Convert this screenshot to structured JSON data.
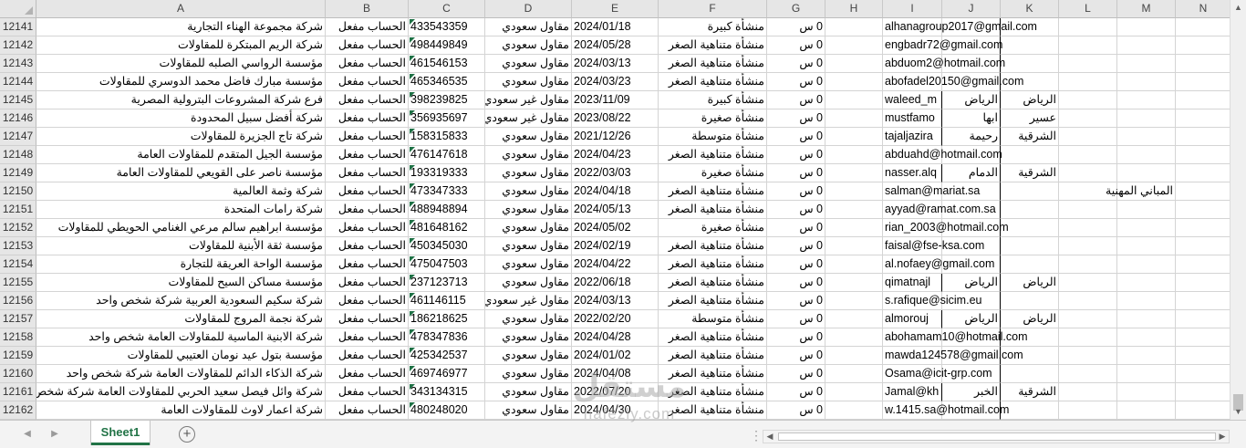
{
  "columns": [
    "A",
    "B",
    "C",
    "D",
    "E",
    "F",
    "G",
    "H",
    "I",
    "J",
    "K",
    "L",
    "M",
    "N"
  ],
  "rows": [
    {
      "num": "12141",
      "A": "شركة مجموعة الهناء التجارية",
      "B": "الحساب مفعل",
      "C": "433543359",
      "D": "مقاول سعودي",
      "E": "2024/01/18",
      "F": "منشأة كبيرة",
      "G": "0 س",
      "H": "",
      "I": "alhanagroup2017@gmail.com",
      "J": "",
      "K": "",
      "L": "",
      "M": ""
    },
    {
      "num": "12142",
      "A": "شركة الريم المبتكرة للمقاولات",
      "B": "الحساب مفعل",
      "C": "498449849",
      "D": "مقاول سعودي",
      "E": "2024/05/28",
      "F": "منشأة متناهية الصغر",
      "G": "0 س",
      "H": "",
      "I": "engbadr72@gmail.com",
      "J": "",
      "K": "",
      "L": "",
      "M": ""
    },
    {
      "num": "12143",
      "A": "مؤسسة الرواسي الصلبه للمقاولات",
      "B": "الحساب مفعل",
      "C": "461546153",
      "D": "مقاول سعودي",
      "E": "2024/03/13",
      "F": "منشأة متناهية الصغر",
      "G": "0 س",
      "H": "",
      "I": "abduom2@hotmail.com",
      "J": "",
      "K": "",
      "L": "",
      "M": ""
    },
    {
      "num": "12144",
      "A": "مؤسسة مبارك فاضل محمد الدوسري للمقاولات",
      "B": "الحساب مفعل",
      "C": "465346535",
      "D": "مقاول سعودي",
      "E": "2024/03/23",
      "F": "منشأة متناهية الصغر",
      "G": "0 س",
      "H": "",
      "I": "abofadel20150@gmail.com",
      "J": "",
      "K": "",
      "L": "",
      "M": ""
    },
    {
      "num": "12145",
      "A": "فرع شركة المشروعات البترولية المصرية",
      "B": "الحساب مفعل",
      "C": "398239825",
      "D": "مقاول غير سعودي",
      "E": "2023/11/09",
      "F": "منشأة كبيرة",
      "G": "0 س",
      "H": "",
      "I": "waleed_m",
      "J": "الرياض",
      "K": "الرياض",
      "L": "",
      "M": ""
    },
    {
      "num": "12146",
      "A": "شركة أفضل سبيل المحدودة",
      "B": "الحساب مفعل",
      "C": "356935697",
      "D": "مقاول غير سعودي",
      "E": "2023/08/22",
      "F": "منشأة صغيرة",
      "G": "0 س",
      "H": "",
      "I": "mustfamo",
      "J": "ابها",
      "K": "عسير",
      "L": "",
      "M": ""
    },
    {
      "num": "12147",
      "A": "شركة تاج الجزيرة للمقاولات",
      "B": "الحساب مفعل",
      "C": "158315833",
      "D": "مقاول سعودي",
      "E": "2021/12/26",
      "F": "منشأة متوسطة",
      "G": "0 س",
      "H": "",
      "I": "tajaljazira",
      "J": "رحيمة",
      "K": "الشرقية",
      "L": "",
      "M": ""
    },
    {
      "num": "12148",
      "A": "مؤسسة الجيل المتقدم للمقاولات العامة",
      "B": "الحساب مفعل",
      "C": "476147618",
      "D": "مقاول سعودي",
      "E": "2024/04/23",
      "F": "منشأة متناهية الصغر",
      "G": "0 س",
      "H": "",
      "I": "abduahd@hotmail.com",
      "J": "",
      "K": "",
      "L": "",
      "M": ""
    },
    {
      "num": "12149",
      "A": "مؤسسة ناصر على القويعي للمقاولات العامة",
      "B": "الحساب مفعل",
      "C": "193319333",
      "D": "مقاول سعودي",
      "E": "2022/03/03",
      "F": "منشأة صغيرة",
      "G": "0 س",
      "H": "",
      "I": "nasser.alq",
      "J": "الدمام",
      "K": "الشرقية",
      "L": "",
      "M": ""
    },
    {
      "num": "12150",
      "A": "شركة وثمة العالمية",
      "B": "الحساب مفعل",
      "C": "473347333",
      "D": "مقاول سعودي",
      "E": "2024/04/18",
      "F": "منشأة متناهية الصغر",
      "G": "0 س",
      "H": "",
      "I": "salman@mariat.sa",
      "J": "",
      "K": "",
      "L": "",
      "M": "المباني المهنية"
    },
    {
      "num": "12151",
      "A": "شركة رامات المتحدة",
      "B": "الحساب مفعل",
      "C": "488948894",
      "D": "مقاول سعودي",
      "E": "2024/05/13",
      "F": "منشأة متناهية الصغر",
      "G": "0 س",
      "H": "",
      "I": "ayyad@ramat.com.sa",
      "J": "",
      "K": "",
      "L": "",
      "M": ""
    },
    {
      "num": "12152",
      "A": "مؤسسة ابراهيم سالم مرعي الغنامي الحويطي للمقاولات",
      "B": "الحساب مفعل",
      "C": "481648162",
      "D": "مقاول سعودي",
      "E": "2024/05/02",
      "F": "منشأة صغيرة",
      "G": "0 س",
      "H": "",
      "I": "rian_2003@hotmail.com",
      "J": "",
      "K": "",
      "L": "",
      "M": ""
    },
    {
      "num": "12153",
      "A": "مؤسسة ثقة الأبنية للمقاولات",
      "B": "الحساب مفعل",
      "C": "450345030",
      "D": "مقاول سعودي",
      "E": "2024/02/19",
      "F": "منشأة متناهية الصغر",
      "G": "0 س",
      "H": "",
      "I": "faisal@fse-ksa.com",
      "J": "",
      "K": "",
      "L": "",
      "M": ""
    },
    {
      "num": "12154",
      "A": "مؤسسة الواحة العريقة للتجارة",
      "B": "الحساب مفعل",
      "C": "475047503",
      "D": "مقاول سعودي",
      "E": "2024/04/22",
      "F": "منشأة متناهية الصغر",
      "G": "0 س",
      "H": "",
      "I": "al.nofaey@gmail.com",
      "J": "",
      "K": "",
      "L": "",
      "M": ""
    },
    {
      "num": "12155",
      "A": "مؤسسة مساكن السيح للمقاولات",
      "B": "الحساب مفعل",
      "C": "237123713",
      "D": "مقاول سعودي",
      "E": "2022/06/18",
      "F": "منشأة متناهية الصغر",
      "G": "0 س",
      "H": "",
      "I": "qimatnajl",
      "J": "الرياض",
      "K": "الرياض",
      "L": "",
      "M": ""
    },
    {
      "num": "12156",
      "A": "شركة سكيم السعودية العربية شركة شخص واحد",
      "B": "الحساب مفعل",
      "C": "461146115",
      "D": "مقاول غير سعودي",
      "E": "2024/03/13",
      "F": "منشأة متناهية الصغر",
      "G": "0 س",
      "H": "",
      "I": "s.rafique@sicim.eu",
      "J": "",
      "K": "",
      "L": "",
      "M": ""
    },
    {
      "num": "12157",
      "A": "شركة نجمة المروج للمقاولات",
      "B": "الحساب مفعل",
      "C": "186218625",
      "D": "مقاول سعودي",
      "E": "2022/02/20",
      "F": "منشأة متوسطة",
      "G": "0 س",
      "H": "",
      "I": "almorouj",
      "J": "الرياض",
      "K": "الرياض",
      "L": "",
      "M": ""
    },
    {
      "num": "12158",
      "A": "شركة الابنية الماسية للمقاولات العامة شخص واحد",
      "B": "الحساب مفعل",
      "C": "478347836",
      "D": "مقاول سعودي",
      "E": "2024/04/28",
      "F": "منشأة متناهية الصغر",
      "G": "0 س",
      "H": "",
      "I": "abohamam10@hotmail.com",
      "J": "",
      "K": "",
      "L": "",
      "M": ""
    },
    {
      "num": "12159",
      "A": "مؤسسة بتول عيد نومان العتيبي للمقاولات",
      "B": "الحساب مفعل",
      "C": "425342537",
      "D": "مقاول سعودي",
      "E": "2024/01/02",
      "F": "منشأة متناهية الصغر",
      "G": "0 س",
      "H": "",
      "I": "mawda124578@gmail.com",
      "J": "",
      "K": "",
      "L": "",
      "M": ""
    },
    {
      "num": "12160",
      "A": "شركة الذكاء الدائم للمقاولات العامة شركة شخص واحد",
      "B": "الحساب مفعل",
      "C": "469746977",
      "D": "مقاول سعودي",
      "E": "2024/04/08",
      "F": "منشأة متناهية الصغر",
      "G": "0 س",
      "H": "",
      "I": "Osama@icit-grp.com",
      "J": "",
      "K": "",
      "L": "",
      "M": ""
    },
    {
      "num": "12161",
      "A": "شركة وائل فيصل سعيد الحربي للمقاولات العامة شركة شخص واحد",
      "B": "الحساب مفعل",
      "C": "343134315",
      "D": "مقاول سعودي",
      "E": "2022/07/20",
      "F": "منشأة متناهية الصغر",
      "G": "0 س",
      "H": "",
      "I": "Jamal@kh",
      "J": "الخبر",
      "K": "الشرقية",
      "L": "",
      "M": ""
    },
    {
      "num": "12162",
      "A": "شركة اعمار لاوث للمقاولات العامة",
      "B": "الحساب مفعل",
      "C": "480248020",
      "D": "مقاول سعودي",
      "E": "2024/04/30",
      "F": "منشأة متناهية الصغر",
      "G": "0 س",
      "H": "",
      "I": "w.1415.sa@hotmail.com",
      "J": "",
      "K": "",
      "L": "",
      "M": ""
    }
  ],
  "sheet_tab": "Sheet1",
  "add_sheet": "+",
  "watermark": {
    "logo": "مستقل",
    "text": "nafezly.com"
  },
  "icons": {
    "prev": "triangle-left-icon",
    "next": "triangle-right-icon",
    "up": "triangle-up-icon",
    "down": "triangle-down-icon",
    "tab_options": "ellipsis-icon"
  },
  "colors": {
    "accent": "#217346",
    "header_bg": "#e6e6e6",
    "gridline": "#d4d4d4",
    "number_marker": "#1e7145"
  }
}
